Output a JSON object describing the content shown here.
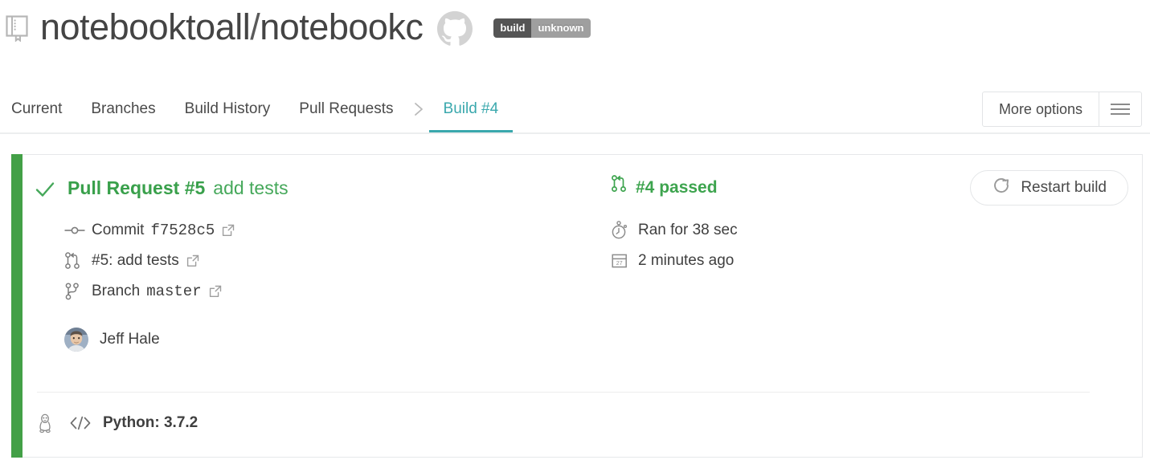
{
  "header": {
    "repo_icon": "book-icon",
    "owner": "notebooktoall",
    "separator": "/",
    "repo": "notebookc",
    "title_full": "notebooktoall / notebookc",
    "vcs_icon": "github-icon",
    "badge": {
      "label": "build",
      "value": "unknown",
      "label_bg": "#555555",
      "value_bg": "#9f9f9f"
    }
  },
  "nav": {
    "tabs": [
      {
        "label": "Current",
        "active": false
      },
      {
        "label": "Branches",
        "active": false
      },
      {
        "label": "Build History",
        "active": false
      },
      {
        "label": "Pull Requests",
        "active": false
      }
    ],
    "breadcrumb_icon": "chevron-right-icon",
    "active_tab": "Build #4",
    "active_color": "#3aa8ad",
    "more_options_label": "More options",
    "menu_icon": "hamburger-icon"
  },
  "build": {
    "status_color": "#43a047",
    "status_icon": "check-icon",
    "pr_title": "Pull Request #5",
    "pr_subject": "add tests",
    "build_status_icon": "pull-request-icon",
    "build_status_text": "#4 passed",
    "restart_label": "Restart build",
    "restart_icon": "restart-icon",
    "meta_left": [
      {
        "icon": "commit-icon",
        "label": "Commit",
        "value": "f7528c5",
        "mono": true,
        "external": true
      },
      {
        "icon": "pull-request-icon",
        "label": "#5: add tests",
        "value": "",
        "mono": false,
        "external": true
      },
      {
        "icon": "branch-icon",
        "label": "Branch",
        "value": "master",
        "mono": true,
        "external": true
      }
    ],
    "meta_right": [
      {
        "icon": "stopwatch-icon",
        "text": "Ran for 38 sec"
      },
      {
        "icon": "calendar-icon",
        "text": "2 minutes ago"
      }
    ],
    "author": {
      "avatar_icon": "avatar",
      "name": "Jeff Hale"
    },
    "environment": {
      "os_icon": "linux-penguin-icon",
      "lang_icon": "code-icon",
      "text": "Python: 3.7.2"
    }
  }
}
